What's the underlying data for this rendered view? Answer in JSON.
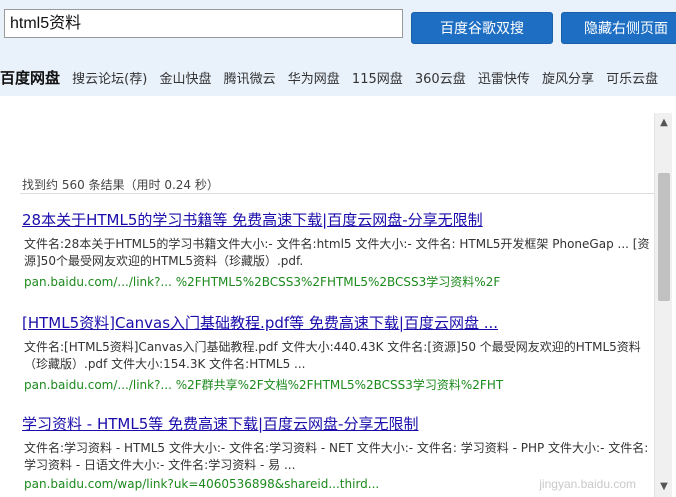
{
  "search": {
    "value": "html5资料"
  },
  "buttons": {
    "dual_search": "百度谷歌双搜",
    "hide_right": "隐藏右侧页面"
  },
  "sites": [
    "百度网盘",
    "搜云论坛(荐)",
    "金山快盘",
    "腾讯微云",
    "华为网盘",
    "115网盘",
    "360云盘",
    "迅雷快传",
    "旋风分享",
    "可乐云盘"
  ],
  "results_count": "找到约 560 条结果（用时 0.24 秒）",
  "results": [
    {
      "title_pre": "28本关于HTML5的学习书籍等  免费高速下载|百度云网盘-分享无限制",
      "desc": "文件名:28本关于HTML5的学习书籍文件大小:- 文件名:html5 文件大小:- 文件名: HTML5开发框架 PhoneGap ... [资源]50个最受网友欢迎的HTML5资料（珍藏版）.pdf.",
      "url": "pan.baidu.com/.../link?... %2FHTML5%2BCSS3%2FHTML5%2BCSS3学习资料%2F"
    },
    {
      "title_pre": "[HTML5资料]Canvas入门基础教程.pdf等  免费高速下载|百度云网盘 ...",
      "desc": "文件名:[HTML5资料]Canvas入门基础教程.pdf 文件大小:440.43K 文件名:[资源]50 个最受网友欢迎的HTML5资料（珍藏版）.pdf 文件大小:154.3K 文件名:HTML5 ...",
      "url": "pan.baidu.com/.../link?... %2F群共享%2F文档%2FHTML5%2BCSS3学习资料%2FHT"
    },
    {
      "title_pre": "学习资料 - HTML5等  免费高速下载|百度云网盘-分享无限制",
      "desc": "文件名:学习资料 - HTML5 文件大小:- 文件名:学习资料 - NET 文件大小:- 文件名: 学习资料 - PHP 文件大小:- 文件名:学习资料 - 日语文件大小:- 文件名:学习资料 - 易  ...",
      "url": "pan.baidu.com/wap/link?uk=4060536898&shareid...third..."
    }
  ],
  "watermark": "jingyan.baidu.com"
}
